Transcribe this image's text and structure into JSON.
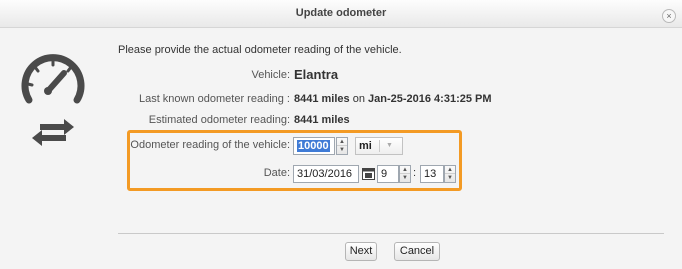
{
  "dialog": {
    "title": "Update odometer",
    "close_icon": "×"
  },
  "intro_text": "Please provide the actual odometer reading of the vehicle.",
  "vehicle": {
    "label": "Vehicle:",
    "value": "Elantra"
  },
  "last_known": {
    "label": "Last known odometer reading :",
    "miles": "8441 miles",
    "on_text": " on ",
    "date": "Jan-25-2016 4:31:25 PM"
  },
  "estimated": {
    "label": "Estimated odometer reading:",
    "value": "8441 miles"
  },
  "odometer_field": {
    "label": "Odometer reading of the vehicle:",
    "value": "10000"
  },
  "unit_select": {
    "value": "mi"
  },
  "date_field": {
    "label": "Date:",
    "value": "31/03/2016",
    "hour": "9",
    "colon": ":",
    "minute": "13"
  },
  "buttons": {
    "next": "Next",
    "cancel": "Cancel"
  },
  "colors": {
    "highlight_frame": "#f39a24",
    "selection": "#3f7bd6"
  },
  "icons": [
    "speedometer-icon",
    "sync-arrows-icon",
    "calendar-icon",
    "close-icon",
    "chevron-down-icon"
  ]
}
